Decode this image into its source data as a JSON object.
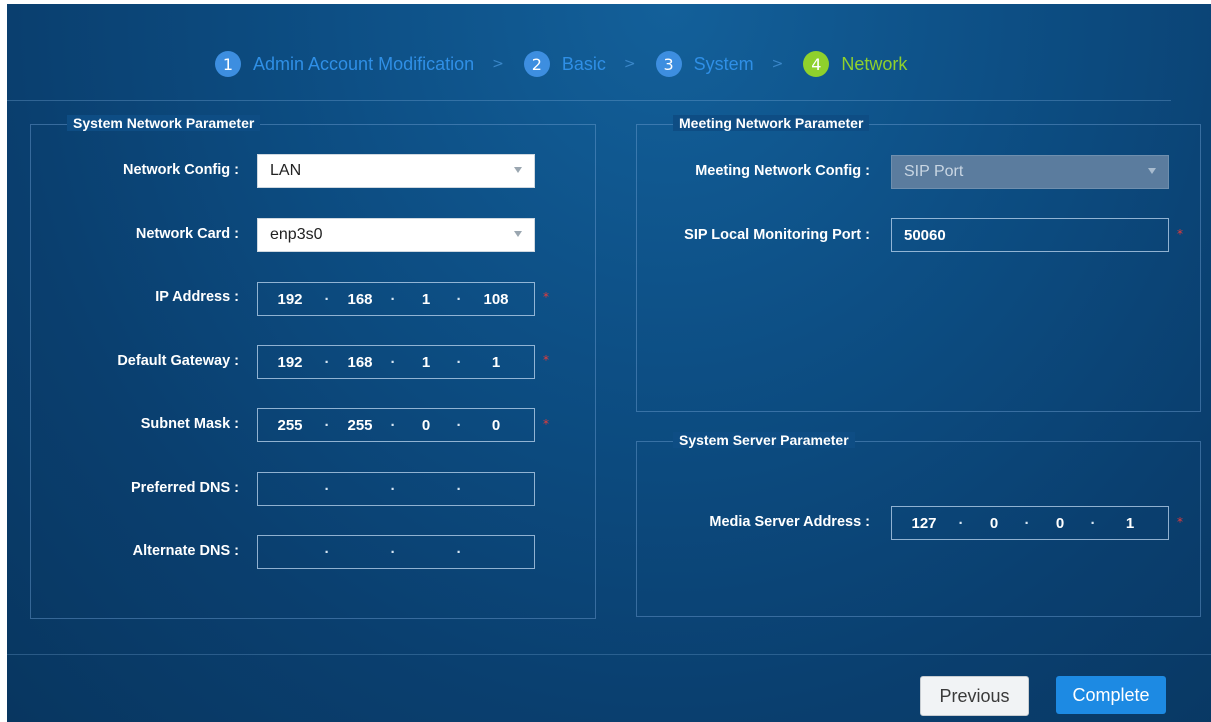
{
  "steps": [
    {
      "num": "1",
      "label": "Admin Account Modification",
      "active": false
    },
    {
      "num": "2",
      "label": "Basic",
      "active": false
    },
    {
      "num": "3",
      "label": "System",
      "active": false
    },
    {
      "num": "4",
      "label": "Network",
      "active": true
    }
  ],
  "step_separator": ">",
  "system_network": {
    "title": "System Network Parameter",
    "network_config": {
      "label": "Network Config :",
      "value": "LAN"
    },
    "network_card": {
      "label": "Network Card :",
      "value": "enp3s0"
    },
    "ip_address": {
      "label": "IP Address :",
      "octets": [
        "192",
        "168",
        "1",
        "108"
      ],
      "required": true
    },
    "default_gateway": {
      "label": "Default Gateway :",
      "octets": [
        "192",
        "168",
        "1",
        "1"
      ],
      "required": true
    },
    "subnet_mask": {
      "label": "Subnet Mask :",
      "octets": [
        "255",
        "255",
        "0",
        "0"
      ],
      "required": true
    },
    "preferred_dns": {
      "label": "Preferred DNS :",
      "octets": [
        "",
        "",
        "",
        ""
      ]
    },
    "alternate_dns": {
      "label": "Alternate DNS :",
      "octets": [
        "",
        "",
        "",
        ""
      ]
    }
  },
  "meeting_network": {
    "title": "Meeting Network Parameter",
    "meeting_network_config": {
      "label": "Meeting Network Config :",
      "value": "SIP Port",
      "disabled": true
    },
    "sip_port": {
      "label": "SIP Local Monitoring Port :",
      "value": "50060",
      "required": true
    }
  },
  "system_server": {
    "title": "System Server Parameter",
    "media_server": {
      "label": "Media Server Address :",
      "octets": [
        "127",
        "0",
        "0",
        "1"
      ],
      "required": true
    }
  },
  "buttons": {
    "previous": "Previous",
    "complete": "Complete"
  },
  "required_mark": "*",
  "ip_dot": "·",
  "colors": {
    "step_active": "#8fd12c",
    "step_inactive": "#3d8ee0",
    "button_primary": "#1d8ae3",
    "required": "#e53b3b"
  }
}
